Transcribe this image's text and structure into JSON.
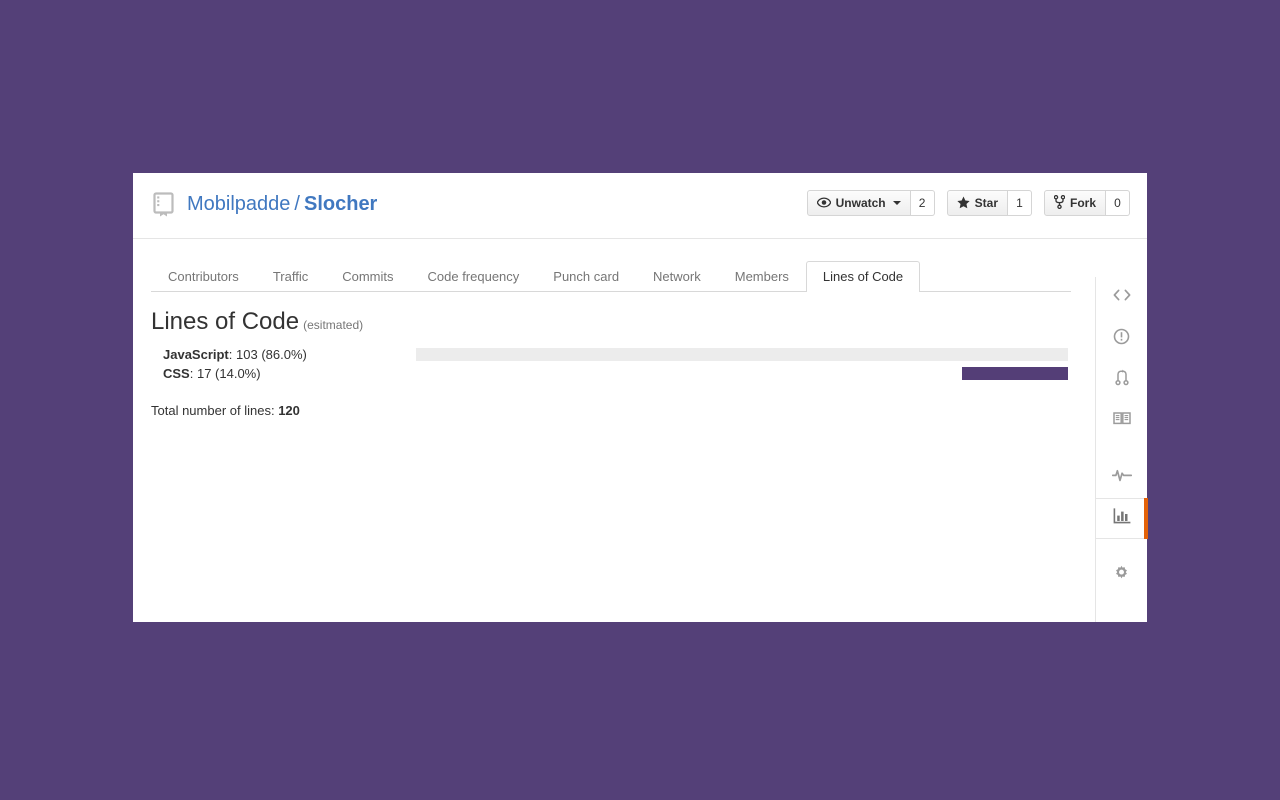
{
  "theme": {
    "background": "#544078",
    "card_background": "#ffffff",
    "link_blue": "#4078c0",
    "accent_orange": "#e36209",
    "bar_purple": "#543e77",
    "bar_track_gray": "#ececec",
    "muted_text": "#767676"
  },
  "repo": {
    "icon": "repo-icon",
    "owner": "Mobilpadde",
    "separator": "/",
    "name": "Slocher"
  },
  "actions": [
    {
      "id": "unwatch",
      "icon": "eye-icon",
      "label": "Unwatch",
      "has_caret": true,
      "count": "2"
    },
    {
      "id": "star",
      "icon": "star-icon",
      "label": "Star",
      "has_caret": false,
      "count": "1"
    },
    {
      "id": "fork",
      "icon": "repo-forked-icon",
      "label": "Fork",
      "has_caret": false,
      "count": "0"
    }
  ],
  "tabs": [
    {
      "id": "contributors",
      "label": "Contributors",
      "active": false
    },
    {
      "id": "traffic",
      "label": "Traffic",
      "active": false
    },
    {
      "id": "commits",
      "label": "Commits",
      "active": false
    },
    {
      "id": "code-frequency",
      "label": "Code frequency",
      "active": false
    },
    {
      "id": "punch-card",
      "label": "Punch card",
      "active": false
    },
    {
      "id": "network",
      "label": "Network",
      "active": false
    },
    {
      "id": "members",
      "label": "Members",
      "active": false
    },
    {
      "id": "lines-of-code",
      "label": "Lines of Code",
      "active": true
    }
  ],
  "main": {
    "heading": "Lines of Code",
    "heading_sub": "(esitmated)",
    "total_label": "Total number of lines:",
    "total_value": "120"
  },
  "chart_data": {
    "type": "bar",
    "title": "Lines of Code (esitmated)",
    "orientation": "horizontal",
    "categories": [
      "JavaScript",
      "CSS"
    ],
    "values": [
      103,
      17
    ],
    "percentages": [
      86.0,
      14.0
    ],
    "total": 120,
    "labels": [
      "JavaScript: 103 (86.0%)",
      "CSS: 17 (14.0%)"
    ],
    "bar_colors": [
      "#ececec",
      "#543e77"
    ],
    "xlabel": "",
    "ylabel": "",
    "grid": false,
    "legend": false
  },
  "languages": [
    {
      "name": "JavaScript",
      "value_text": "103 (86.0%)",
      "lines": 103,
      "percent": 86.0,
      "bar_color": "#ececec",
      "bar_width_pct": 100
    },
    {
      "name": "CSS",
      "value_text": "17 (14.0%)",
      "lines": 17,
      "percent": 14.0,
      "bar_color": "#543e77",
      "bar_width_pct": 16.3
    }
  ],
  "sidebar": [
    {
      "id": "code",
      "icon": "code-icon",
      "active": false
    },
    {
      "id": "issues",
      "icon": "issue-opened-icon",
      "active": false
    },
    {
      "id": "pull-requests",
      "icon": "git-pull-request-icon",
      "active": false
    },
    {
      "id": "wiki",
      "icon": "book-icon",
      "active": false
    },
    {
      "id": "pulse",
      "icon": "pulse-icon",
      "active": false
    },
    {
      "id": "graphs",
      "icon": "graph-icon",
      "active": true
    },
    {
      "id": "settings",
      "icon": "gear-icon",
      "active": false
    }
  ]
}
